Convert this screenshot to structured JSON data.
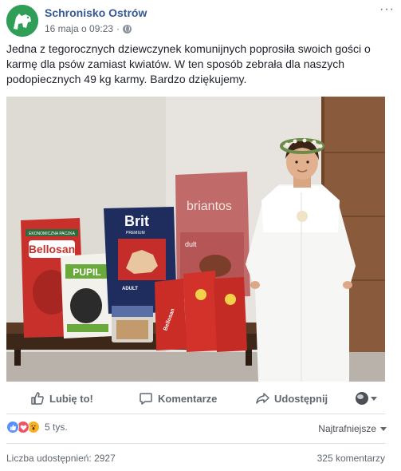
{
  "header": {
    "page_name": "Schronisko Ostrów",
    "timestamp": "16 maja o 09:23",
    "separator": "·",
    "more_label": "···"
  },
  "post": {
    "text": "Jedna z tegorocznych dziewczynek komunijnych poprosiła swoich gości o karmę dla psów zamiast kwiatów. W ten sposób zebrała dla naszych podopiecznych 49 kg karmy. Bardzo dziękujemy."
  },
  "photo": {
    "labels": {
      "bag1_top": "EKONOMICZNA PACZKA",
      "bag1": "Bellosan",
      "bag2_top": "Brit",
      "bag2_sub": "PREMIUM",
      "bag2_adult": "ADULT",
      "bag3": "briantos",
      "bag3_sub": "dult",
      "bag4": "PUPIL",
      "small_bags": "Bellosan"
    }
  },
  "actions": {
    "like": "Lubię to!",
    "comment": "Komentarze",
    "share": "Udostępnij"
  },
  "reactions": {
    "count": "5 tys.",
    "sort_label": "Najtrafniejsze"
  },
  "footer": {
    "shares": "Liczba udostępnień: 2927",
    "comments": "325 komentarzy"
  },
  "colors": {
    "brand_blue": "#365899",
    "like": "#5890ff",
    "love": "#f25268",
    "wow": "#f7b125",
    "avatar_green": "#2f9e56"
  }
}
